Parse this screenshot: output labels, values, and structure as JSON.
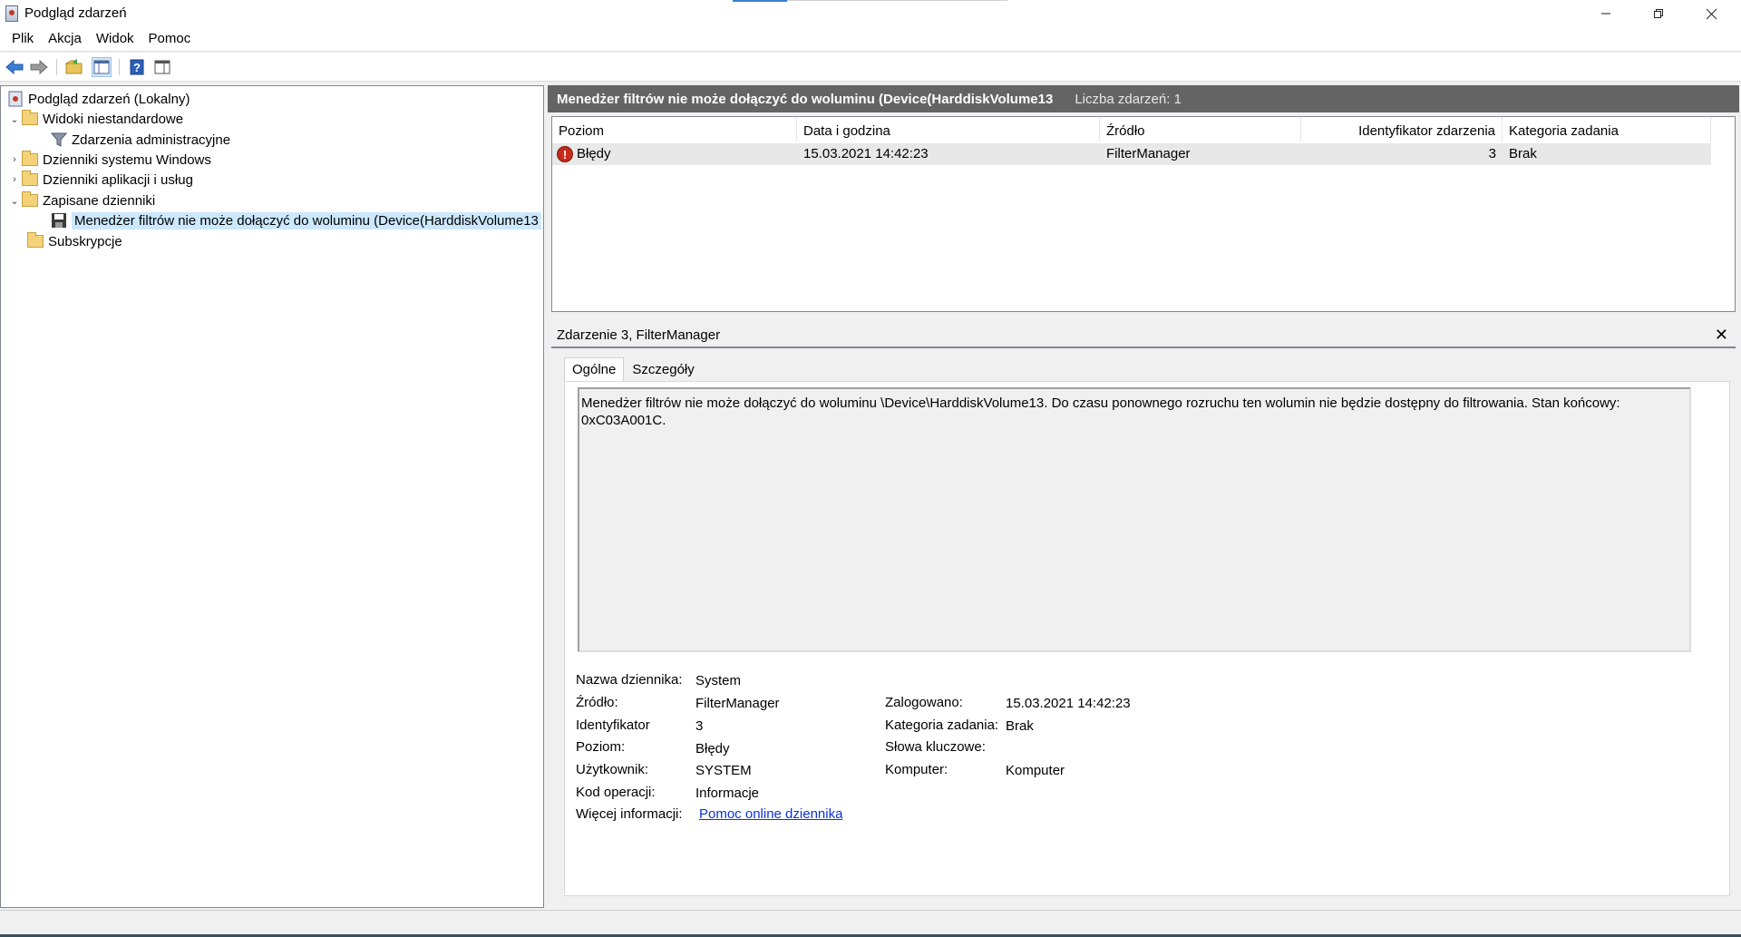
{
  "window": {
    "title": "Podgląd zdarzeń",
    "minimize_icon": "minimize-icon",
    "maximize_icon": "restore-icon",
    "close_icon": "close-icon"
  },
  "menu": [
    "Plik",
    "Akcja",
    "Widok",
    "Pomoc"
  ],
  "toolbar": [
    "back-arrow-icon",
    "forward-arrow-icon",
    "open-folder-icon",
    "show-hide-tree-icon",
    "help-icon",
    "show-hide-action-pane-icon"
  ],
  "tree": {
    "root": "Podgląd zdarzeń (Lokalny)",
    "custom_views": "Widoki niestandardowe",
    "admin_events": "Zdarzenia administracyjne",
    "windows_logs": "Dzienniki systemu Windows",
    "app_logs": "Dzienniki aplikacji i usług",
    "saved_logs": "Zapisane dzienniki",
    "saved_log_item": "Menedżer filtrów nie może dołączyć do woluminu (Device(HarddiskVolume13",
    "subscriptions": "Subskrypcje"
  },
  "header": {
    "title": "Menedżer filtrów nie może dołączyć do woluminu (Device(HarddiskVolume13",
    "count": "Liczba zdarzeń: 1"
  },
  "grid": {
    "columns": [
      "Poziom",
      "Data i godzina",
      "Źródło",
      "Identyfikator zdarzenia",
      "Kategoria zadania"
    ],
    "rows": [
      {
        "level": "Błędy",
        "datetime": "15.03.2021 14:42:23",
        "source": "FilterManager",
        "id": "3",
        "category": "Brak"
      }
    ]
  },
  "detail": {
    "title": "Zdarzenie 3, FilterManager",
    "close": "✕",
    "tabs": [
      "Ogólne",
      "Szczegóły"
    ],
    "message": "Menedżer filtrów nie może dołączyć do woluminu \\Device\\HarddiskVolume13. Do czasu ponownego rozruchu ten wolumin nie będzie dostępny do filtrowania. Stan końcowy: 0xC03A001C.",
    "fields": {
      "log_name_label": "Nazwa dziennika:",
      "log_name": "System",
      "source_label": "Źródło:",
      "source": "FilterManager",
      "logged_label": "Zalogowano:",
      "logged": "15.03.2021 14:42:23",
      "id_label": "Identyfikator",
      "id": "3",
      "task_label": "Kategoria zadania:",
      "task": "Brak",
      "level_label": "Poziom:",
      "level": "Błędy",
      "keywords_label": "Słowa kluczowe:",
      "keywords": "",
      "user_label": "Użytkownik:",
      "user": "SYSTEM",
      "computer_label": "Komputer:",
      "computer": "Komputer",
      "opcode_label": "Kod operacji:",
      "opcode": "Informacje",
      "more_label": "Więcej informacji:",
      "more_link": "Pomoc online dziennika"
    }
  }
}
